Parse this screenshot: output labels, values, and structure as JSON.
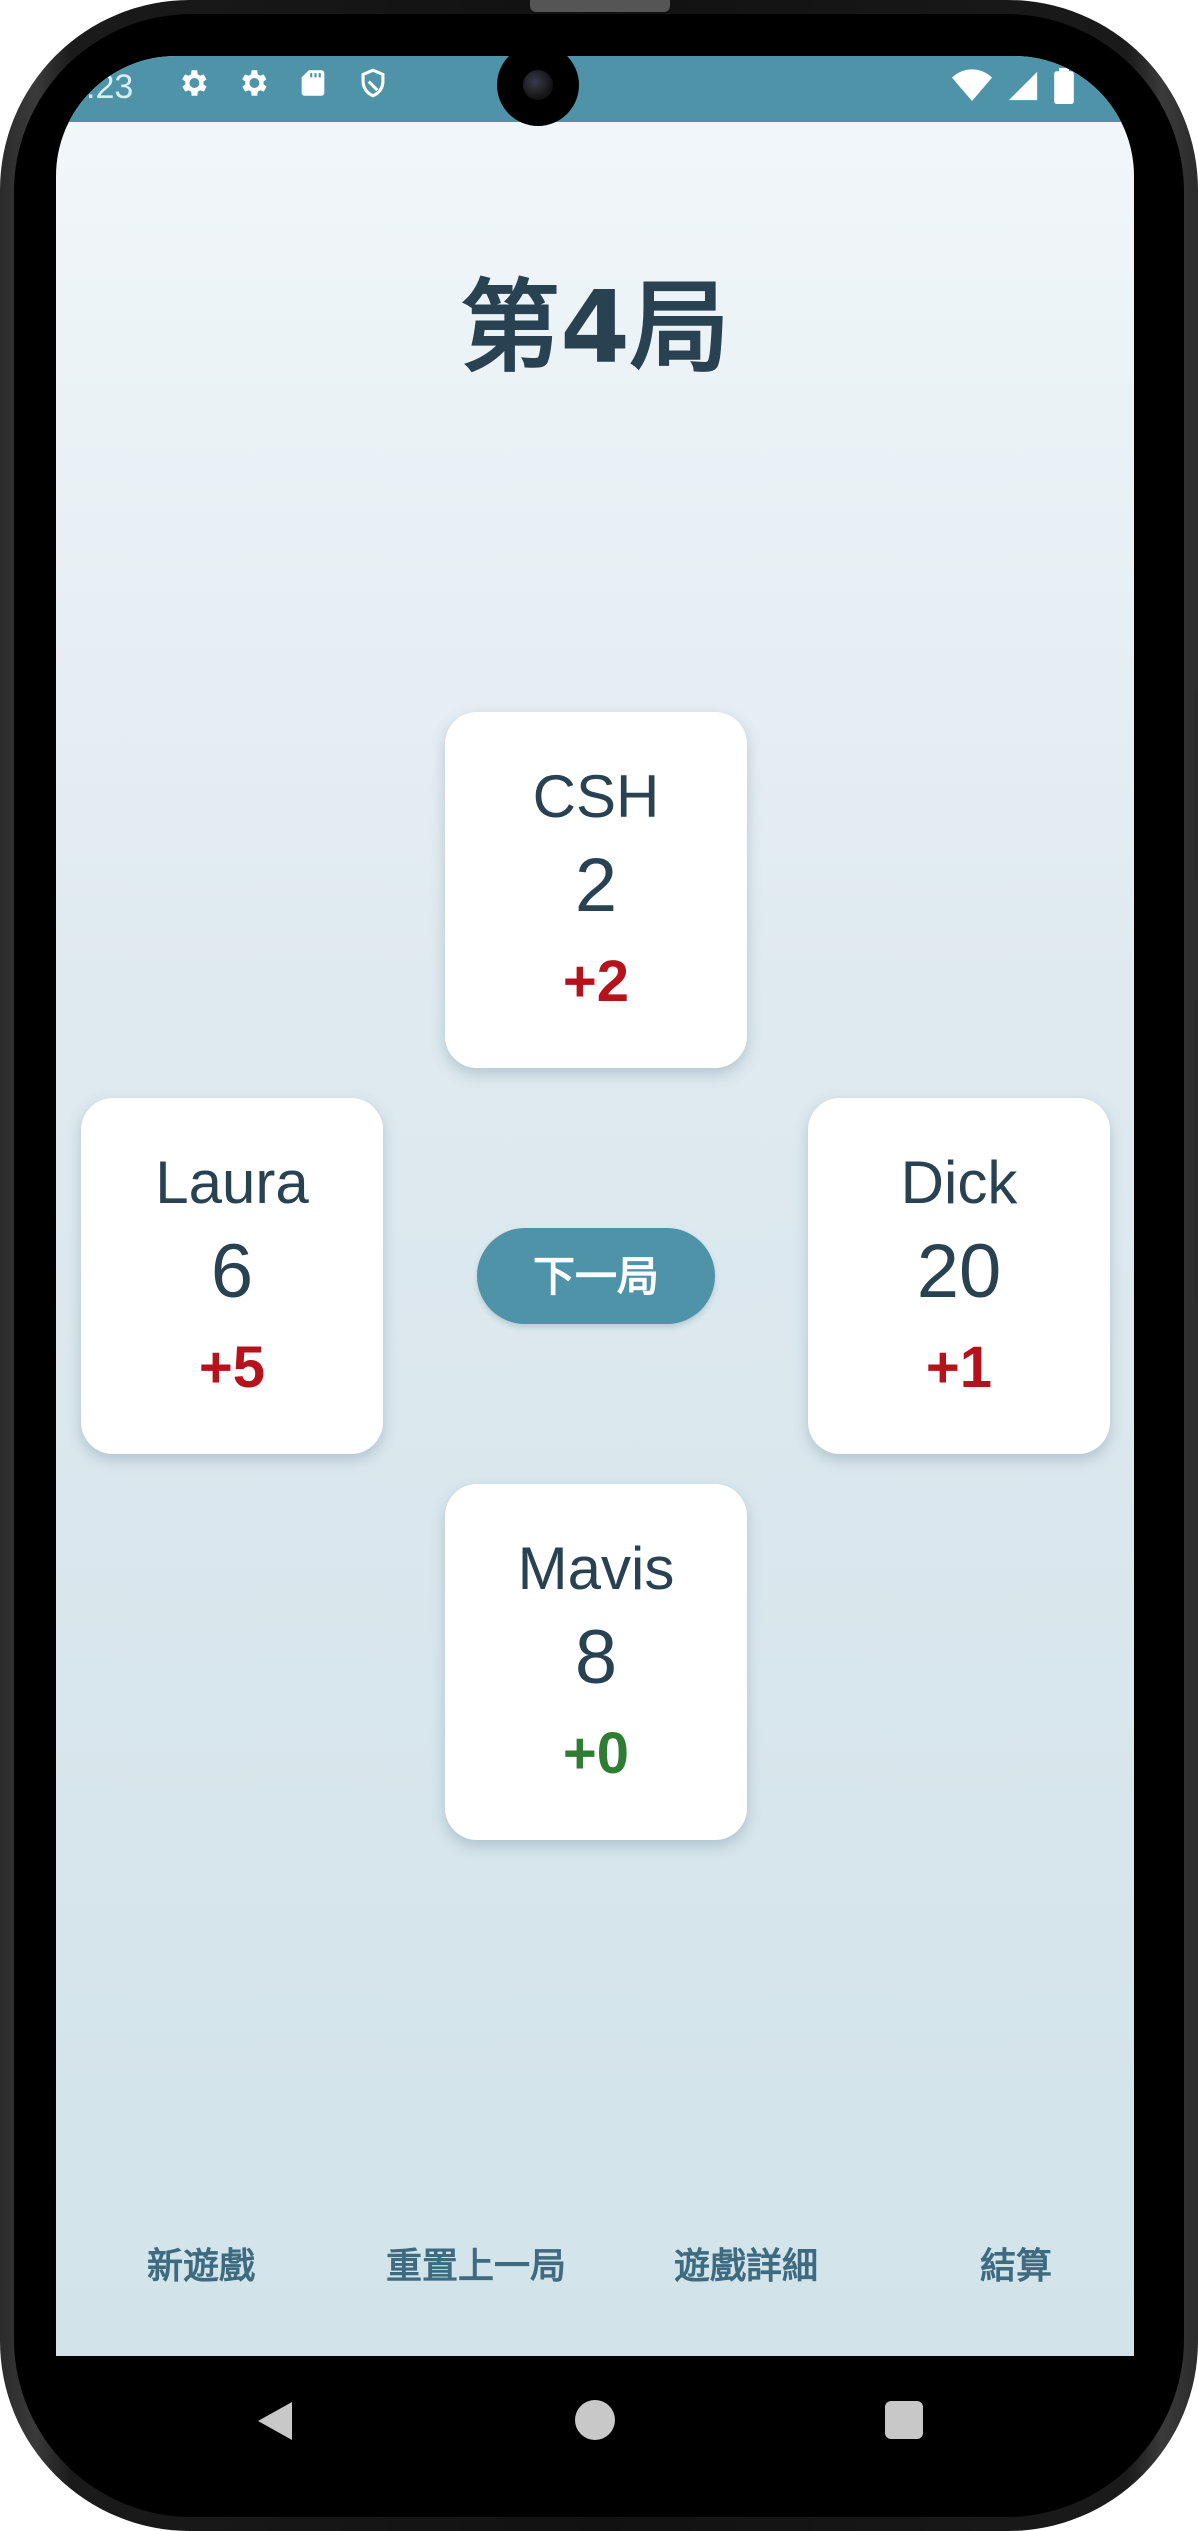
{
  "status_bar": {
    "time": ":23",
    "left_icons": [
      "gear-icon",
      "gear-icon",
      "sd-card-icon",
      "shield-icon"
    ],
    "right_icons": [
      "wifi-icon",
      "signal-icon",
      "battery-icon"
    ]
  },
  "game": {
    "round_title": "第4局",
    "next_round_label": "下一局",
    "players": {
      "top": {
        "name": "CSH",
        "score": "2",
        "delta": "+2",
        "delta_color": "#b5121b"
      },
      "left": {
        "name": "Laura",
        "score": "6",
        "delta": "+5",
        "delta_color": "#b5121b"
      },
      "right": {
        "name": "Dick",
        "score": "20",
        "delta": "+1",
        "delta_color": "#b5121b"
      },
      "bottom": {
        "name": "Mavis",
        "score": "8",
        "delta": "+0",
        "delta_color": "#2e7d32"
      }
    }
  },
  "actions": {
    "new_game": "新遊戲",
    "reset_last_round": "重置上一局",
    "game_details": "遊戲詳細",
    "settle": "結算"
  },
  "nav": {
    "icons": [
      "back-icon",
      "home-icon",
      "recent-apps-icon"
    ]
  },
  "colors": {
    "accent": "#4e93a8",
    "text_primary": "#284252",
    "positive_red": "#b5121b",
    "zero_green": "#2e7d32"
  }
}
